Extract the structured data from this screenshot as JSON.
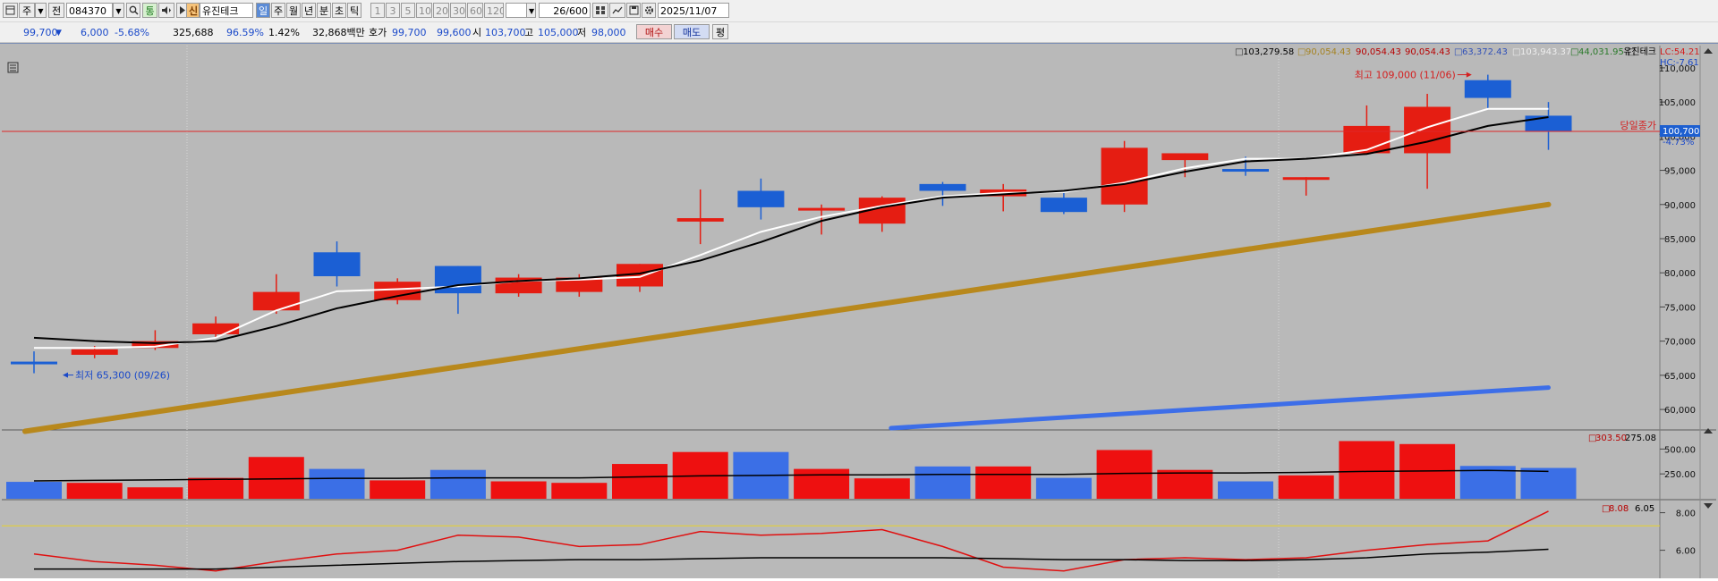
{
  "toolbar": {
    "market_btn": "주",
    "prev_btn": "▼",
    "jeon_btn": "전",
    "code": "084370",
    "code_dd": "▼",
    "search_icon": "search-icon",
    "tong_btn": "통",
    "shin_badge": "신",
    "stock_name": "유진테크",
    "periods": [
      "일",
      "주",
      "월",
      "년",
      "분",
      "초",
      "틱"
    ],
    "numbers": [
      "1",
      "3",
      "5",
      "10",
      "20",
      "30",
      "60",
      "120"
    ],
    "count": "26",
    "count_total": "/600",
    "date": "2025/11/07"
  },
  "quote": {
    "price": "99,700",
    "arrow": "▼",
    "change": "6,000",
    "change_pct": "-5.68%",
    "volume": "325,688",
    "vol_ratio": "96.59%",
    "turnover": "1.42%",
    "amount": "32,868백만",
    "hoga_label": "호가",
    "ask": "99,700",
    "bid": "99,600",
    "open_label": "시",
    "open": "103,700",
    "high_label": "고",
    "high": "105,000",
    "low_label": "저",
    "low": "98,000",
    "buy_btn": "매수",
    "sell_btn": "매도",
    "pyeong_btn": "평"
  },
  "legend": {
    "v1": "103,279.58",
    "v2": "90,054.43",
    "v3": "90,054.43",
    "v4": "90,054.43",
    "v5": "63,372.43",
    "v6": "103,943.37",
    "v7": "44,031.95",
    "name": "유진테크",
    "lc": "LC:54.21",
    "hc": "HC:-7.61"
  },
  "annotations": {
    "high": "최고 109,000 (11/06)",
    "low": "최저 65,300 (09/26)",
    "close_label": "당일종가",
    "close_price": "100,700",
    "close_pct": "-4.73%"
  },
  "volume_legend": {
    "a": "303.50",
    "b": "275.08"
  },
  "osc_legend": {
    "a": "8.08",
    "b": "6.05"
  },
  "chart_data": {
    "type": "candlestick",
    "ylim": [
      57000,
      113000
    ],
    "price_ticks": [
      "110,000",
      "105,000",
      "100,000",
      "95,000",
      "90,000",
      "85,000",
      "80,000",
      "75,000",
      "70,000",
      "65,000",
      "60,000"
    ],
    "candles": [
      {
        "o": 67000,
        "c": 67000,
        "h": 68500,
        "l": 65300,
        "up": false
      },
      {
        "o": 68000,
        "c": 68800,
        "h": 69300,
        "l": 67500,
        "up": true
      },
      {
        "o": 69000,
        "c": 70000,
        "h": 71600,
        "l": 68700,
        "up": true
      },
      {
        "o": 71000,
        "c": 72600,
        "h": 73600,
        "l": 70400,
        "up": true
      },
      {
        "o": 74500,
        "c": 77200,
        "h": 79800,
        "l": 74000,
        "up": true
      },
      {
        "o": 83000,
        "c": 79500,
        "h": 84600,
        "l": 78000,
        "up": false
      },
      {
        "o": 76000,
        "c": 78700,
        "h": 79200,
        "l": 75400,
        "up": true
      },
      {
        "o": 81000,
        "c": 77000,
        "h": 81000,
        "l": 74000,
        "up": false
      },
      {
        "o": 77000,
        "c": 79300,
        "h": 79800,
        "l": 76500,
        "up": true
      },
      {
        "o": 77200,
        "c": 79300,
        "h": 79800,
        "l": 76500,
        "up": true
      },
      {
        "o": 78000,
        "c": 81300,
        "h": 81300,
        "l": 77200,
        "up": true
      },
      {
        "o": 87500,
        "c": 88000,
        "h": 92200,
        "l": 84200,
        "up": true
      },
      {
        "o": 92000,
        "c": 89600,
        "h": 93800,
        "l": 87800,
        "up": false
      },
      {
        "o": 89300,
        "c": 89500,
        "h": 90000,
        "l": 85600,
        "up": true
      },
      {
        "o": 87200,
        "c": 91000,
        "h": 91200,
        "l": 86000,
        "up": true
      },
      {
        "o": 93000,
        "c": 92000,
        "h": 93300,
        "l": 89800,
        "up": false
      },
      {
        "o": 91200,
        "c": 92200,
        "h": 93000,
        "l": 89000,
        "up": true
      },
      {
        "o": 91000,
        "c": 88900,
        "h": 91800,
        "l": 88600,
        "up": false
      },
      {
        "o": 90000,
        "c": 98300,
        "h": 99300,
        "l": 88900,
        "up": true
      },
      {
        "o": 96500,
        "c": 97500,
        "h": 97500,
        "l": 94000,
        "up": true
      },
      {
        "o": 95200,
        "c": 95000,
        "h": 97000,
        "l": 94200,
        "up": false
      },
      {
        "o": 94000,
        "c": 93800,
        "h": 94000,
        "l": 91300,
        "up": true
      },
      {
        "o": 97500,
        "c": 101500,
        "h": 104500,
        "l": 97400,
        "up": true
      },
      {
        "o": 97500,
        "c": 104300,
        "h": 106200,
        "l": 92300,
        "up": true
      },
      {
        "o": 108200,
        "c": 105600,
        "h": 109000,
        "l": 104000,
        "up": false
      },
      {
        "o": 103000,
        "c": 100700,
        "h": 105000,
        "l": 98000,
        "up": false
      }
    ],
    "ma_white": [
      69000,
      69000,
      69200,
      70500,
      74500,
      77300,
      77600,
      78000,
      78800,
      79000,
      79400,
      82600,
      86000,
      88200,
      89800,
      91200,
      91700,
      91800,
      93200,
      95300,
      96700,
      96700,
      98000,
      101300,
      104000,
      104000
    ],
    "ma_black": [
      70500,
      70000,
      69700,
      70000,
      72200,
      74800,
      76600,
      78200,
      78800,
      79200,
      79900,
      81800,
      84500,
      87600,
      89600,
      91000,
      91500,
      92000,
      93000,
      94800,
      96300,
      96700,
      97400,
      99200,
      101500,
      102800
    ],
    "ma_gold_range": [
      56800,
      90000
    ],
    "ma_blue_range": [
      54800,
      63200
    ],
    "volume": {
      "ylim": [
        0,
        620
      ],
      "ticks": [
        "500.00",
        "250.00"
      ],
      "values": [
        170,
        160,
        115,
        210,
        420,
        300,
        185,
        290,
        175,
        160,
        350,
        470,
        470,
        300,
        205,
        325,
        325,
        210,
        490,
        290,
        175,
        235,
        580,
        550,
        330,
        310
      ],
      "ma": [
        180,
        185,
        190,
        195,
        200,
        205,
        205,
        210,
        210,
        210,
        220,
        230,
        235,
        240,
        240,
        245,
        245,
        245,
        255,
        260,
        260,
        265,
        275,
        280,
        285,
        275
      ]
    },
    "oscillator": {
      "ylim": [
        4.6,
        8.6
      ],
      "ticks": [
        "8.00",
        "6.00"
      ],
      "level": 7.3,
      "red": [
        5.8,
        5.4,
        5.2,
        4.9,
        5.4,
        5.8,
        6.0,
        6.8,
        6.7,
        6.2,
        6.3,
        7.0,
        6.8,
        6.9,
        7.1,
        6.2,
        5.1,
        4.9,
        5.5,
        5.6,
        5.5,
        5.6,
        6.0,
        6.3,
        6.5,
        8.08
      ],
      "black": [
        5.0,
        5.0,
        5.0,
        5.0,
        5.1,
        5.2,
        5.3,
        5.4,
        5.45,
        5.5,
        5.5,
        5.55,
        5.6,
        5.6,
        5.6,
        5.6,
        5.55,
        5.5,
        5.5,
        5.45,
        5.45,
        5.5,
        5.6,
        5.8,
        5.9,
        6.05
      ]
    }
  }
}
